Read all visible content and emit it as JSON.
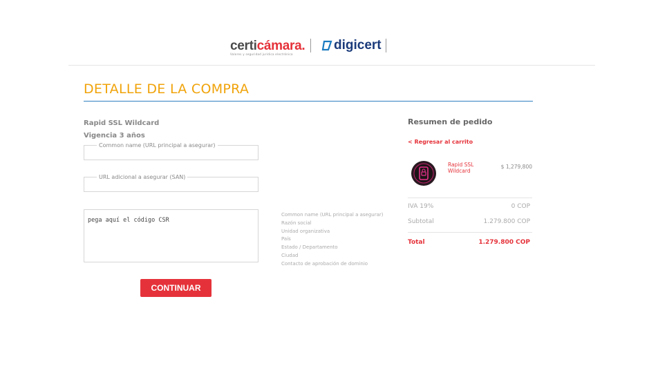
{
  "header": {
    "logo_certi_prefix": "certi",
    "logo_certi_accent": "cámara.",
    "logo_certi_tagline": "Valores y seguridad jurídica electrónica",
    "logo_digicert": "digicert"
  },
  "page": {
    "title": "DETALLE DE LA COMPRA"
  },
  "product": {
    "name": "Rapid SSL Wildcard",
    "validity": "Vigencia 3 años"
  },
  "form": {
    "common_name_label": "Common name (URL principal a asegurar)",
    "san_label": "URL adicional a asegurar (SAN)",
    "csr_placeholder": "pega aquí el  código CSR",
    "csr_help": [
      "Common name (URL principal a asegurar)",
      "Razón social",
      "Unidad organizativa",
      "País",
      "Estado / Departamento",
      "Ciudad",
      "Contacto de aprobación de dominio"
    ],
    "continue_label": "CONTINUAR"
  },
  "summary": {
    "title": "Resumen de pedido",
    "back_link": "< Regresar al carrito",
    "item_name": "Rapid SSL Wildcard",
    "item_price": "$ 1,279,800",
    "iva_label": "IVA 19%",
    "iva_value": "0 COP",
    "subtotal_label": "Subtotal",
    "subtotal_value": "1.279.800 COP",
    "total_label": "Total",
    "total_value": "1.279.800 COP"
  },
  "colors": {
    "accent_red": "#e5323a",
    "title_orange": "#f0a30a",
    "rule_blue": "#2f7fc0",
    "brand_navy": "#1a3a7a"
  },
  "icons": [
    "certicamara-logo",
    "digicert-logo-icon",
    "ssl-product-icon"
  ]
}
